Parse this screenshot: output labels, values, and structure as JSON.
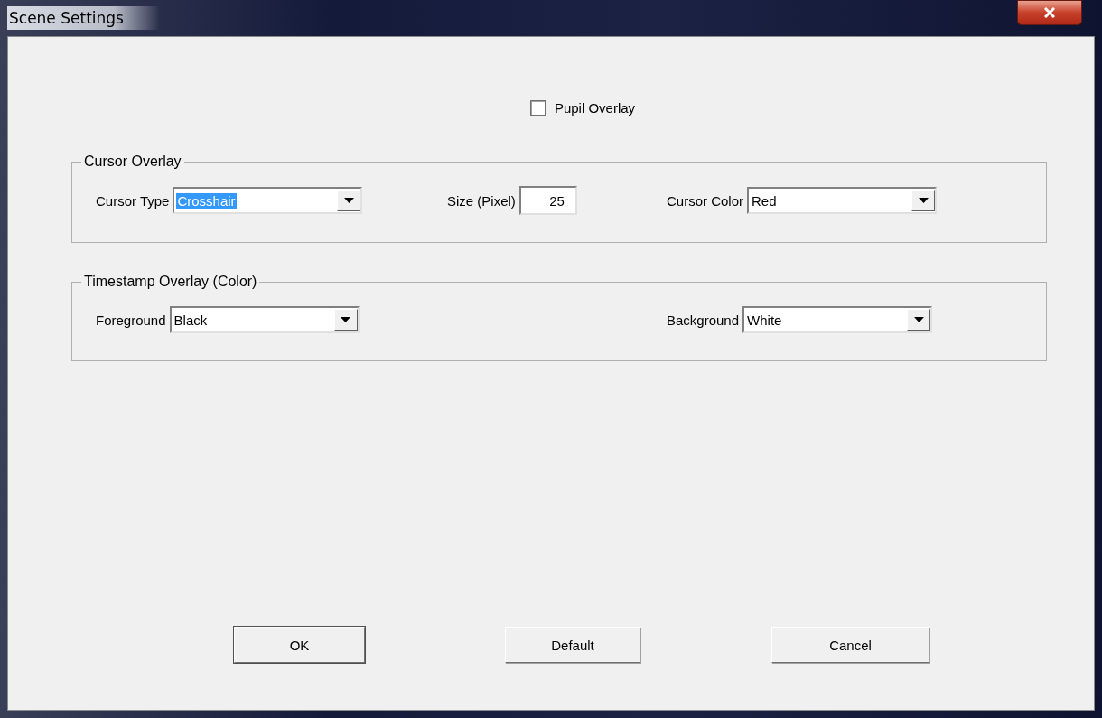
{
  "window": {
    "title": "Scene Settings"
  },
  "pupil_overlay": {
    "label": "Pupil Overlay",
    "checked": false
  },
  "groups": [
    {
      "title": "Cursor Overlay",
      "controls": [
        {
          "kind": "combo",
          "label": "Cursor Type",
          "value": "Crosshair",
          "highlighted": true
        },
        {
          "kind": "number",
          "label": "Size (Pixel)",
          "value": "25"
        },
        {
          "kind": "combo",
          "label": "Cursor Color",
          "value": "Red",
          "highlighted": false
        }
      ]
    },
    {
      "title": "Timestamp Overlay (Color)",
      "controls": [
        {
          "kind": "combo",
          "label": "Foreground",
          "value": "Black",
          "highlighted": false
        },
        {
          "kind": "combo",
          "label": "Background",
          "value": "White",
          "highlighted": false
        }
      ]
    }
  ],
  "buttons": [
    {
      "label": "OK",
      "default": true
    },
    {
      "label": "Default",
      "default": false
    },
    {
      "label": "Cancel",
      "default": false
    }
  ]
}
